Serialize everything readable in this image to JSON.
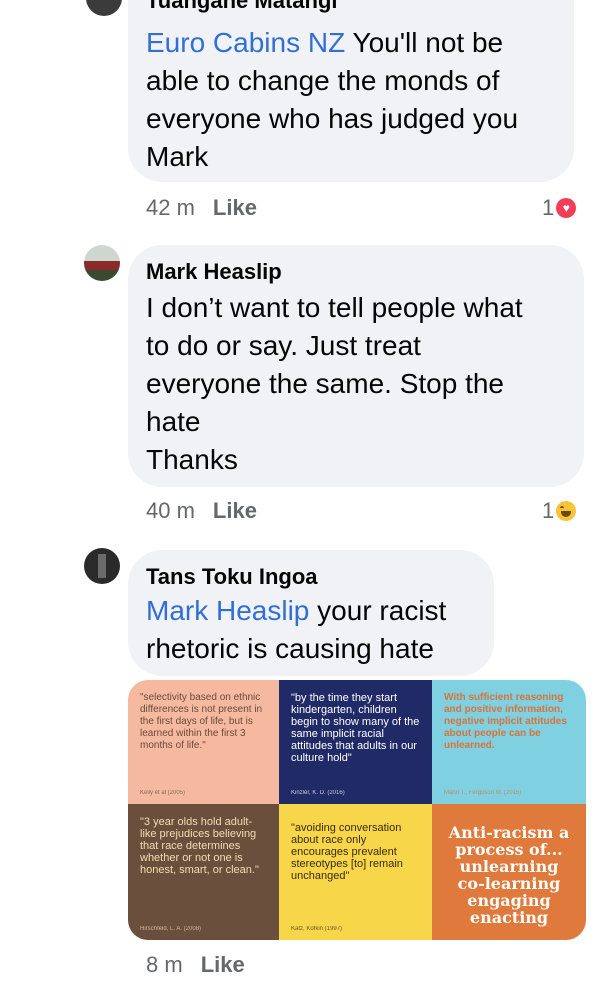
{
  "comments": [
    {
      "author": "Tuangane Matangi",
      "mention": "Euro Cabins NZ",
      "lines": [
        " You'll not be",
        "able to change the monds of",
        "everyone who has judged you",
        "Mark"
      ],
      "time": "42 m",
      "like_label": "Like",
      "reaction_count": "1",
      "reaction_icon": "heart-icon"
    },
    {
      "author": "Mark Heaslip",
      "lines": [
        "I don’t want to tell people what",
        "to do or say. Just treat",
        "everyone the same. Stop the",
        "hate",
        "Thanks"
      ],
      "time": "40 m",
      "like_label": "Like",
      "reaction_count": "1",
      "reaction_icon": "haha-icon"
    },
    {
      "author": "Tans Toku Ingoa",
      "mention": "Mark Heaslip",
      "lines": [
        " your racist",
        "rhetoric is causing hate"
      ],
      "time": "8 m",
      "like_label": "Like"
    }
  ],
  "collage": {
    "tiles": [
      {
        "quote": "\"selectivity based on ethnic differences is not present in the first days of life, but is learned within the first 3 months of life.\"",
        "cite": "Kelly et al (2005)",
        "bg": "#f4b99e",
        "fg": "#6b4a3a"
      },
      {
        "quote": "\"by the time they start kindergarten, children begin to show many of the same implicit racial attitudes that adults in our culture hold\"",
        "cite": "Kinzler, K. D. (2016)",
        "bg": "#1f2a66",
        "fg": "#ffffff"
      },
      {
        "quote": "With sufficient reasoning and positive information, negative implicit attitudes about people can be unlearned.",
        "cite": "Mann T., Ferguson M. (2015)",
        "bg": "#7fd0e0",
        "fg": "#d9733a"
      },
      {
        "quote": "\"3 year olds hold adult-like prejudices believing that race determines whether or not one is honest, smart, or clean.\"",
        "cite": "Hirschfeld, L. A. (2008)",
        "bg": "#6b4f3d",
        "fg": "#f2dcb3"
      },
      {
        "quote": "\"avoiding conversation about race only encourages prevalent stereotypes [to] remain unchanged\"",
        "cite": "Katz, Kofkin (1997)",
        "bg": "#f7d64a",
        "fg": "#3a2a10"
      },
      {
        "quote": "Anti-racism a process of... unlearning co-learning engaging enacting",
        "cite": "",
        "bg": "#e07a3c",
        "fg": "#ffffff"
      }
    ]
  }
}
